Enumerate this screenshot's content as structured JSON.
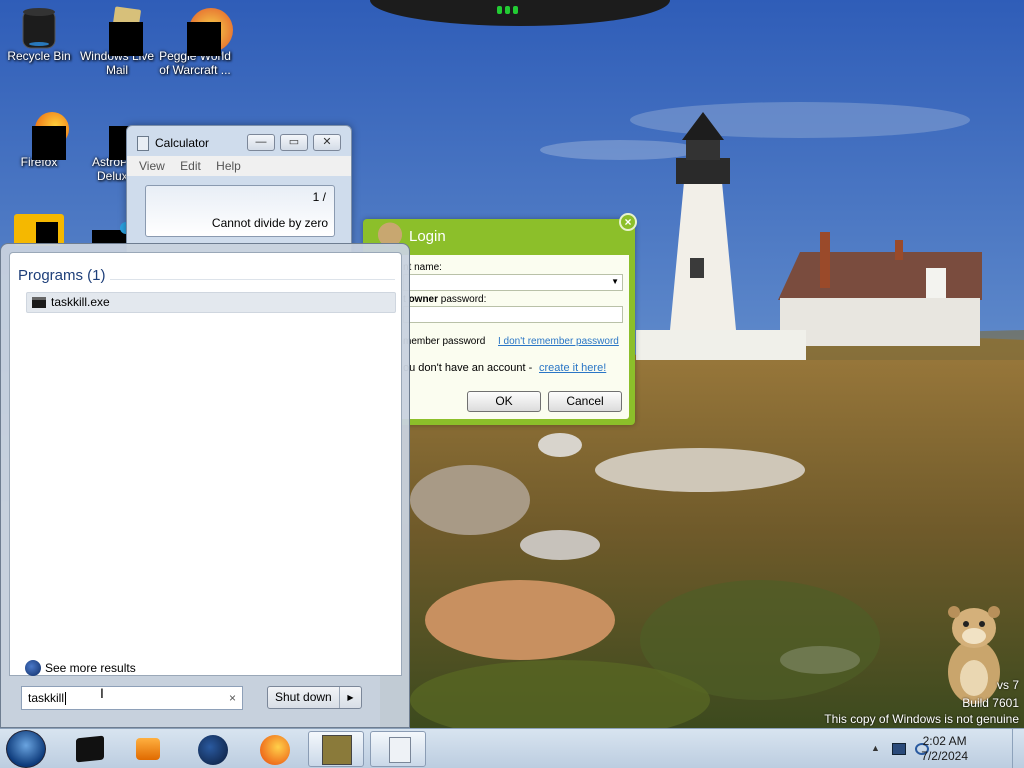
{
  "desktop": {
    "icons": [
      {
        "label_line1": "Recycle Bin",
        "label_line2": ""
      },
      {
        "label_line1": "Windows Live",
        "label_line2": "Mail"
      },
      {
        "label_line1": "Peggle World",
        "label_line2": "of Warcraft ..."
      },
      {
        "label_line1": "Firefox",
        "label_line2": ""
      },
      {
        "label_line1": "AstroP",
        "label_line2": "Delux"
      }
    ]
  },
  "calculator": {
    "title": "Calculator",
    "menu": [
      "View",
      "Edit",
      "Help"
    ],
    "expression": "1  /",
    "result": "Cannot divide by zero",
    "buttons": {
      "minimize": "—",
      "maximize": "▭",
      "close": "✕"
    }
  },
  "login": {
    "title": "Login",
    "close_glyph": "×",
    "account_label": "nt name:",
    "password_label_bold": "owner",
    "password_label_prefix": "t ",
    "password_label_suffix": " password:",
    "remember_label": "member password",
    "forgot_link": "I don't remember password",
    "no_account_text": "ou don't have an account - ",
    "create_link": "create it here!",
    "ok": "OK",
    "cancel": "Cancel"
  },
  "start_menu": {
    "programs_heading": "Programs (1)",
    "results": [
      "taskkill.exe"
    ],
    "see_more": "See more results",
    "search_value": "taskkill",
    "clear_glyph": "×",
    "shutdown_label": "Shut down",
    "shutdown_arrow": "▶"
  },
  "watermark": {
    "line1": "vs 7",
    "line2": "Build 7601",
    "line3": "This copy of Windows is not genuine"
  },
  "taskbar": {
    "time": "2:02 AM",
    "date": "7/2/2024",
    "pinned": [
      "media-center",
      "black-app",
      "media-player",
      "globe",
      "firefox",
      "box-app",
      "calculator"
    ]
  }
}
